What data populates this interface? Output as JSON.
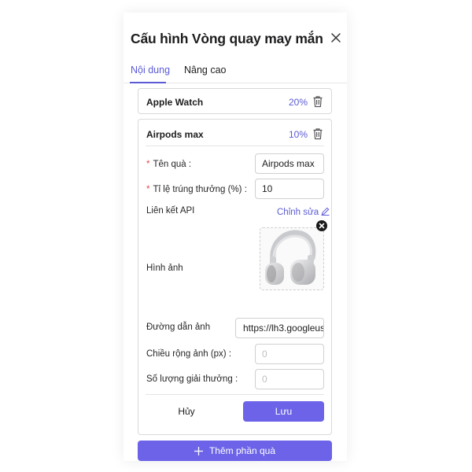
{
  "dialog": {
    "title": "Cấu hình Vòng quay may mắn"
  },
  "tabs": [
    {
      "label": "Nội dung",
      "active": true
    },
    {
      "label": "Nâng cao",
      "active": false
    }
  ],
  "prizes": [
    {
      "name": "Apple Watch",
      "percent": "20%"
    },
    {
      "name": "Airpods max",
      "percent": "10%"
    }
  ],
  "form": {
    "gift_name_label": "Tên quà :",
    "gift_name_value": "Airpods max",
    "win_rate_label": "Tỉ lệ trúng thưởng (%) :",
    "win_rate_value": "10",
    "api_link_label": "Liên kết API",
    "api_link_action": "Chỉnh sửa",
    "image_label": "Hình ảnh",
    "image_url_label": "Đường dẫn ảnh",
    "image_url_value": "https://lh3.googleuse",
    "image_width_label": "Chiều rộng ảnh (px) :",
    "image_width_placeholder": "0",
    "prize_count_label": "Số lượng giải thưởng :",
    "prize_count_placeholder": "0",
    "cancel_label": "Hủy",
    "save_label": "Lưu"
  },
  "add_prize_label": "Thêm phần quà",
  "colors": {
    "accent": "#6c63e8",
    "accent_text": "#5b5bd6",
    "required": "#e5484d",
    "border": "#d9d9d9"
  },
  "icons": {
    "close": "close-icon",
    "delete": "trash-icon",
    "edit": "pencil-icon",
    "remove_image": "x-circle-icon",
    "add": "plus-icon"
  }
}
